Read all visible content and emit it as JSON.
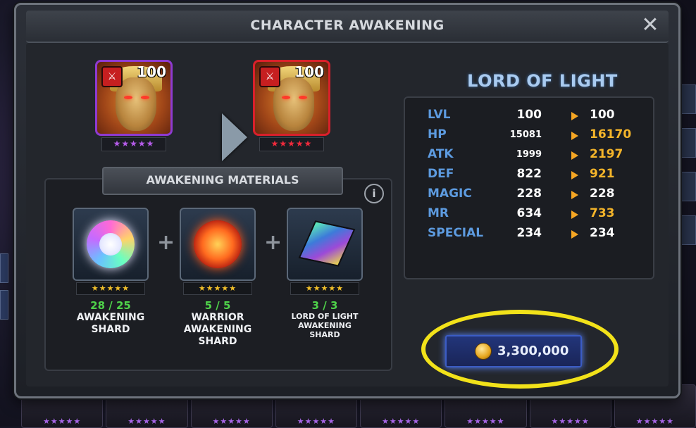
{
  "modal": {
    "title": "CHARACTER AWAKENING",
    "close_glyph": "✕"
  },
  "portraits": {
    "before": {
      "level": "100",
      "stars": "★★★★★",
      "star_color": "purple"
    },
    "after": {
      "level": "100",
      "stars": "★★★★★",
      "star_color": "red"
    }
  },
  "materials": {
    "title": "AWAKENING MATERIALS",
    "info_glyph": "i",
    "plus_glyph": "+",
    "items": [
      {
        "stars": "★★★★★",
        "count": "28 / 25",
        "name_lines": [
          "AWAKENING",
          "SHARD"
        ],
        "icon": "rainbow-orb"
      },
      {
        "stars": "★★★★★",
        "count": "5 / 5",
        "name_lines": [
          "WARRIOR",
          "AWAKENING",
          "SHARD"
        ],
        "icon": "fire-orb"
      },
      {
        "stars": "★★★★★",
        "count": "3 / 3",
        "name_lines": [
          "LORD OF LIGHT",
          "AWAKENING",
          "SHARD"
        ],
        "icon": "light-cube"
      }
    ]
  },
  "character": {
    "name": "LORD OF LIGHT",
    "stats": [
      {
        "label": "LVL",
        "old": "100",
        "new": "100",
        "increased": false
      },
      {
        "label": "HP",
        "old": "15081",
        "new": "16170",
        "increased": true
      },
      {
        "label": "ATK",
        "old": "1999",
        "new": "2197",
        "increased": true
      },
      {
        "label": "DEF",
        "old": "822",
        "new": "921",
        "increased": true
      },
      {
        "label": "MAGIC",
        "old": "228",
        "new": "228",
        "increased": false
      },
      {
        "label": "MR",
        "old": "634",
        "new": "733",
        "increased": true
      },
      {
        "label": "SPECIAL",
        "old": "234",
        "new": "234",
        "increased": false
      }
    ]
  },
  "cost": {
    "amount": "3,300,000",
    "currency_icon": "gold-coin-icon",
    "highlight_color": "#f2e21a"
  },
  "background": {
    "card_stars": [
      "★★★★★",
      "★★★★★",
      "★★★★★",
      "★★★★★",
      "★★★★★",
      "★★★★★",
      "★★★★★",
      "★★★★★"
    ]
  }
}
